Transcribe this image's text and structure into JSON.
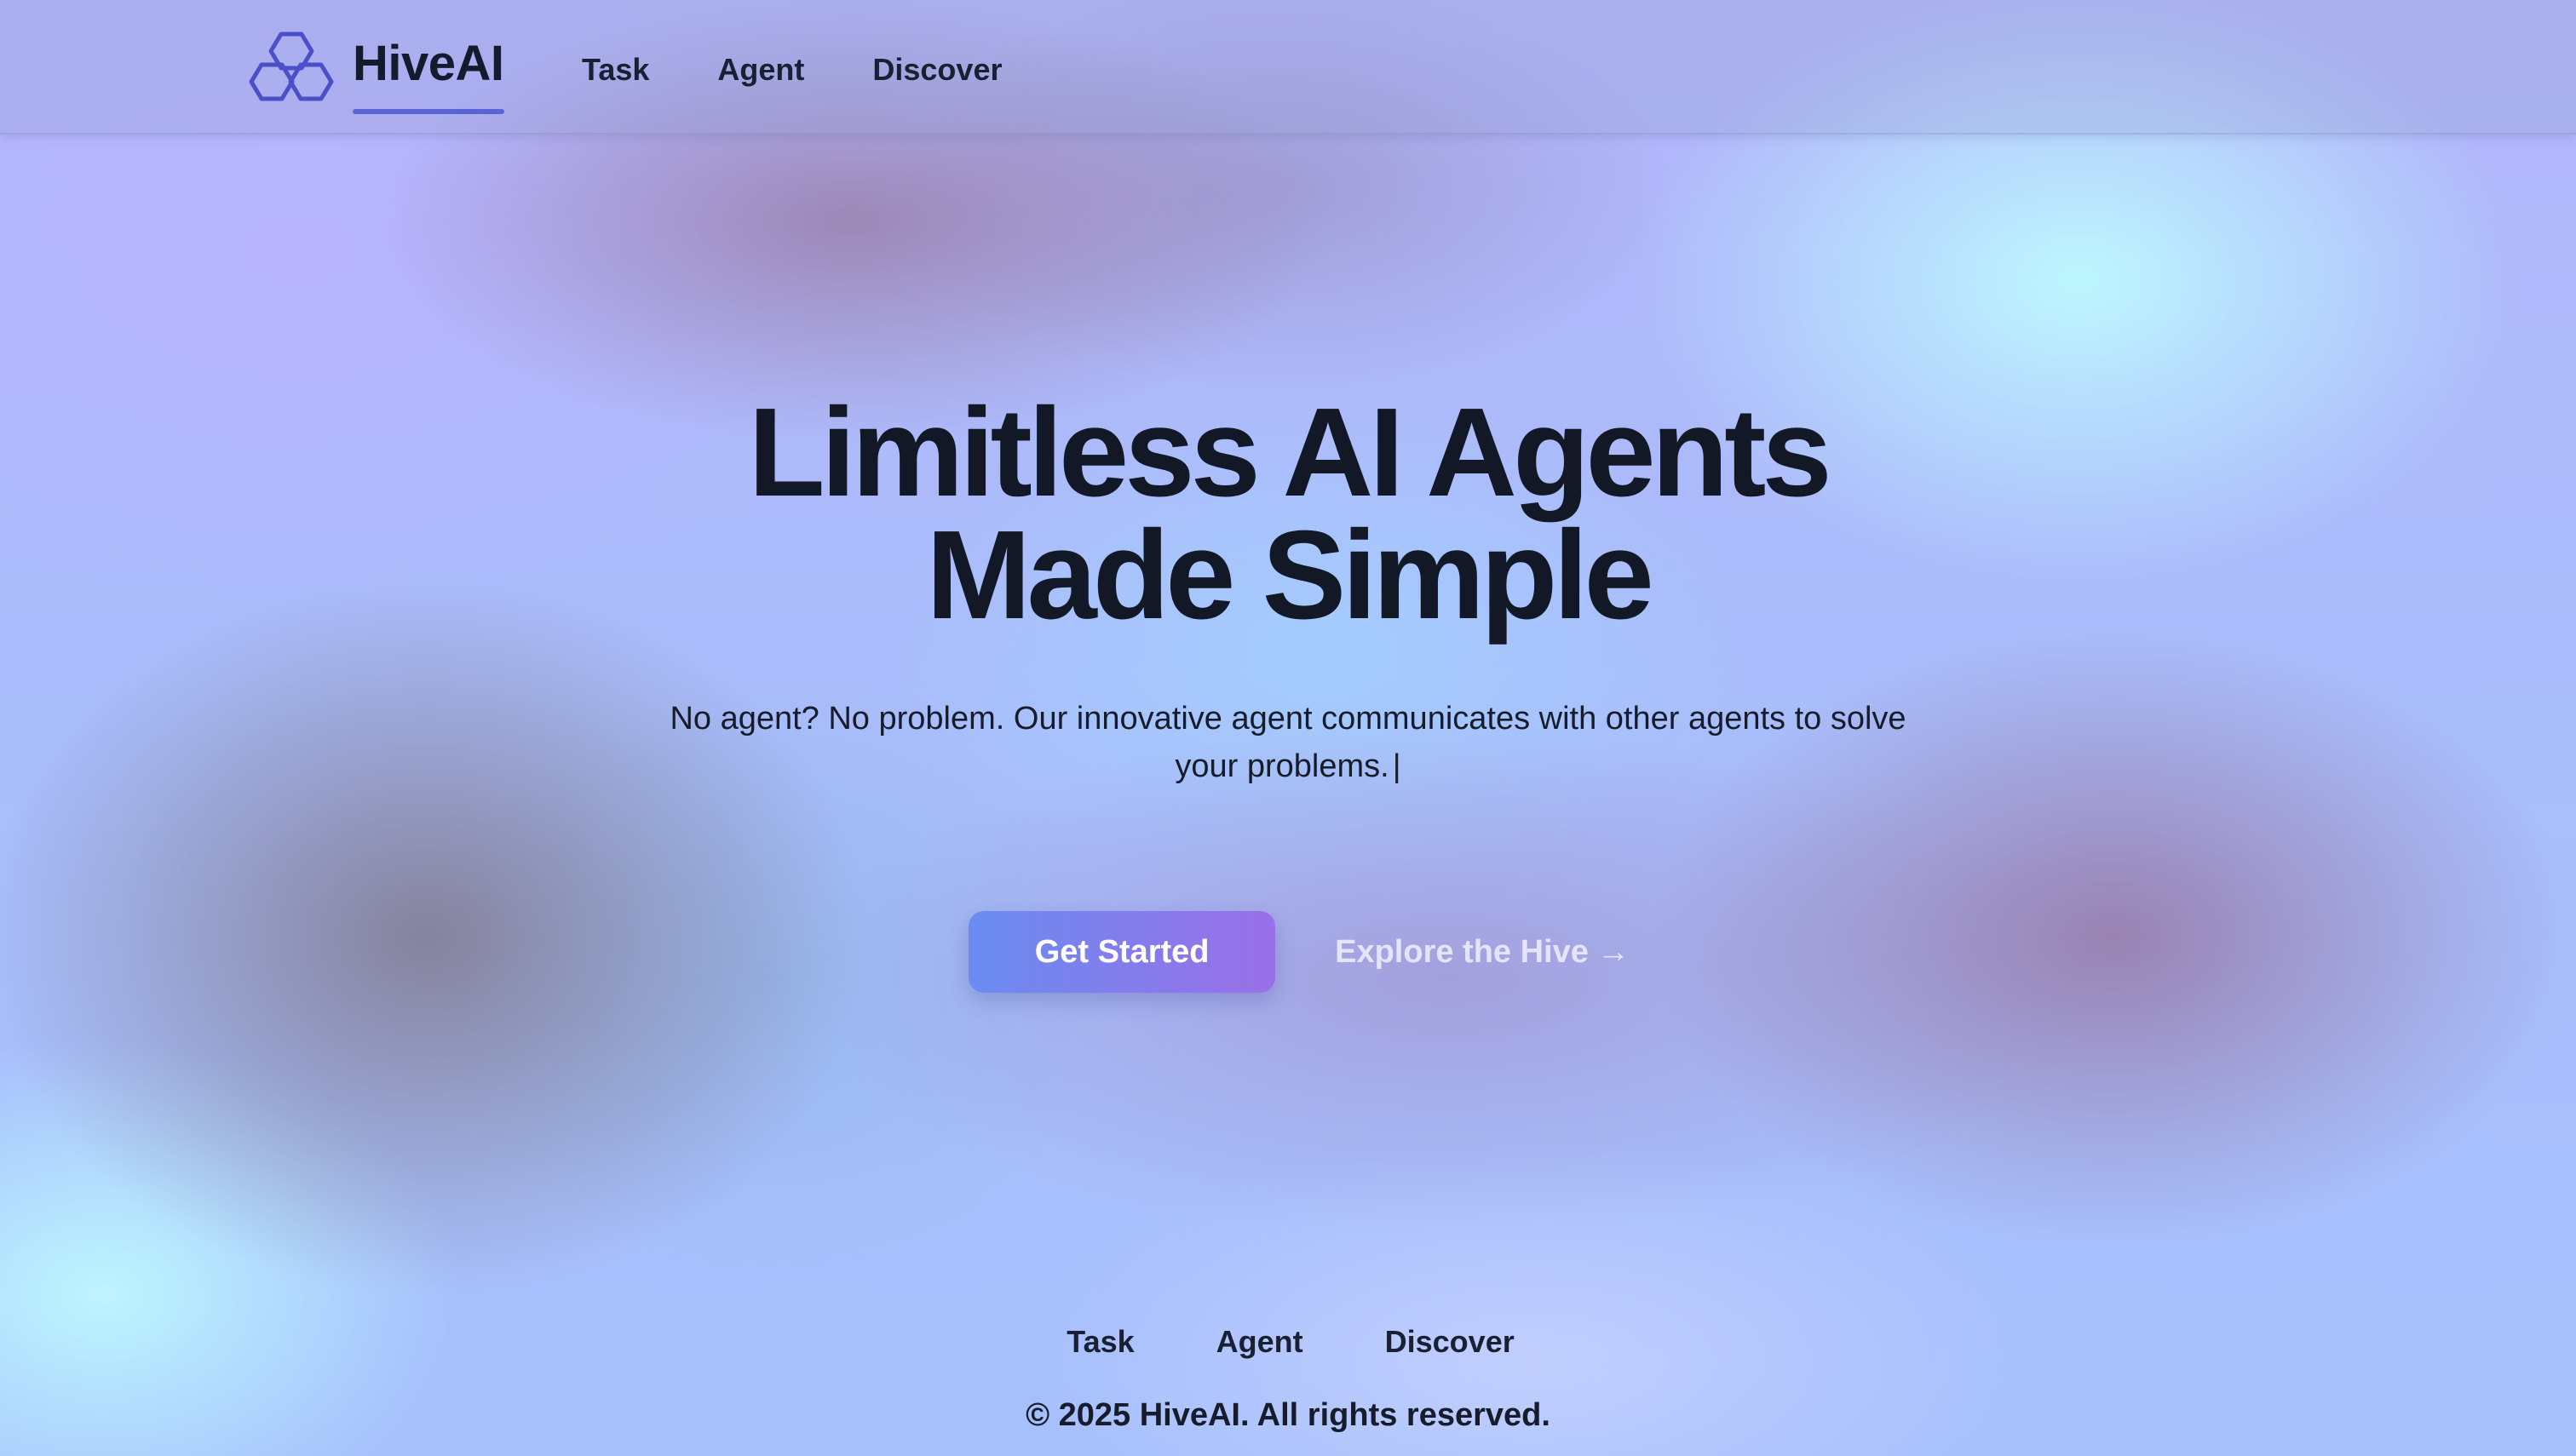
{
  "brand": {
    "name": "HiveAI",
    "icon": "hexagon-cluster-icon",
    "accent_color": "#5b64d6"
  },
  "nav": {
    "items": [
      {
        "label": "Task"
      },
      {
        "label": "Agent"
      },
      {
        "label": "Discover"
      }
    ]
  },
  "hero": {
    "title_line1": "Limitless AI Agents",
    "title_line2": "Made Simple",
    "subtitle": "No agent? No problem. Our innovative agent communicates with other agents to solve your problems.",
    "cursor": "|"
  },
  "cta": {
    "primary_label": "Get Started",
    "primary_gradient": [
      "#6a8cf0",
      "#9b6fe8"
    ],
    "secondary_label": "Explore the Hive",
    "secondary_icon": "arrow-right-icon"
  },
  "footer": {
    "links": [
      {
        "label": "Task"
      },
      {
        "label": "Agent"
      },
      {
        "label": "Discover"
      }
    ],
    "copyright": "© 2025 HiveAI. All rights reserved."
  }
}
